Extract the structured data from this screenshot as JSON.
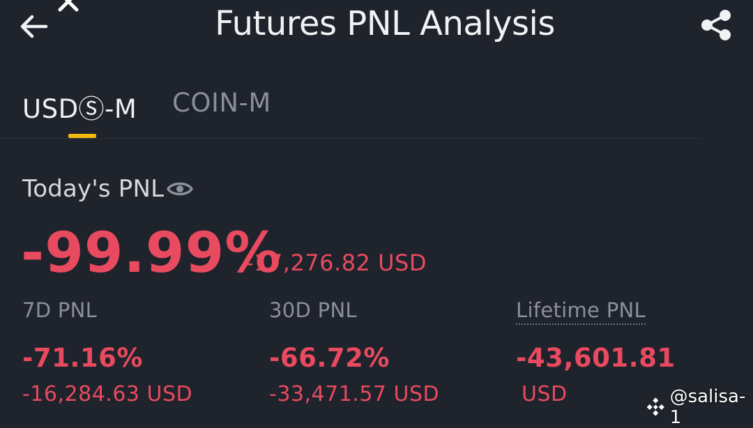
{
  "header": {
    "title": "Futures PNL Analysis"
  },
  "tabs": [
    {
      "label": "USDⓈ-M",
      "active": true
    },
    {
      "label": "COIN-M",
      "active": false
    }
  ],
  "today": {
    "label": "Today's PNL",
    "pct": "-99.99%",
    "usd": "-17,276.82 USD"
  },
  "stats": {
    "d7": {
      "label": "7D PNL",
      "pct": "-71.16%",
      "usd": "-16,284.63 USD"
    },
    "d30": {
      "label": "30D PNL",
      "pct": "-66.72%",
      "usd": "-33,471.57 USD"
    },
    "lifetime": {
      "label": "Lifetime PNL",
      "value": "-43,601.81",
      "unit": "USD"
    }
  },
  "watermark": {
    "text": "@salisa-1"
  },
  "colors": {
    "background": "#1f232c",
    "negative": "#e84a5f",
    "accent": "#f0b90b",
    "muted": "#8c909a"
  },
  "icons": {
    "back": "arrow-left-icon",
    "close": "close-icon",
    "share": "share-icon",
    "visibility": "eye-icon",
    "watermark": "binance-logo-icon"
  }
}
